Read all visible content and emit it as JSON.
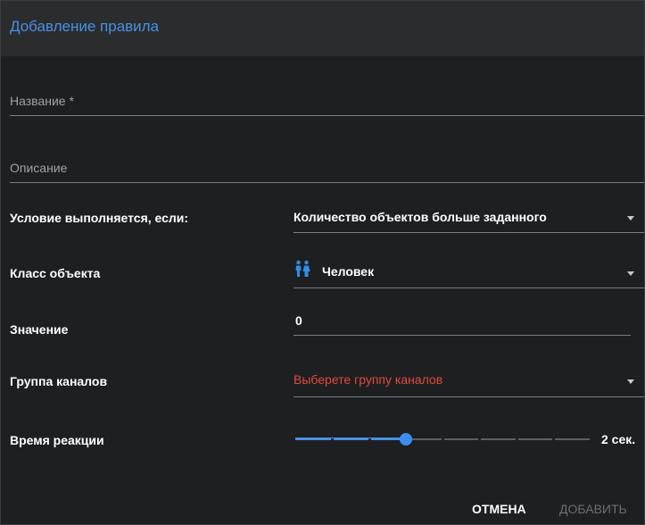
{
  "dialog": {
    "title": "Добавление правила"
  },
  "fields": {
    "name_label": "Название *",
    "description_label": "Описание"
  },
  "condition": {
    "label": "Условие выполняется, если:",
    "value": "Количество объектов больше заданного"
  },
  "object_class": {
    "label": "Класс объекта",
    "value": "Человек",
    "icon": "people-icon",
    "icon_color": "#2f8fe6"
  },
  "value_field": {
    "label": "Значение",
    "value": "0"
  },
  "channel_group": {
    "label": "Группа каналов",
    "placeholder": "Выберете группу каналов",
    "placeholder_color": "#e04a3f"
  },
  "reaction_time": {
    "label": "Время реакции",
    "value_text": "2 сек.",
    "level": 2,
    "max": 8
  },
  "footer": {
    "cancel_label": "ОТМЕНА",
    "add_label": "ДОБАВИТЬ"
  },
  "colors": {
    "accent": "#4a90e2",
    "background": "#1d1f20",
    "header": "#2a2c2e"
  }
}
